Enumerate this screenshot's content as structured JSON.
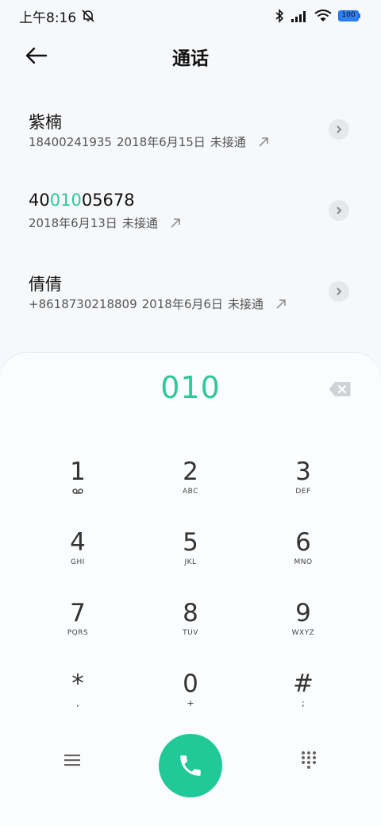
{
  "status_bar": {
    "time": "上午8:16",
    "battery": "100",
    "icons": [
      "alarm-off-icon",
      "bluetooth-icon",
      "signal-icon",
      "wifi-icon",
      "battery-icon"
    ]
  },
  "header": {
    "title": "通话",
    "back_icon": "back-arrow-icon"
  },
  "calls": [
    {
      "name_parts": [
        "紫楠",
        "",
        ""
      ],
      "number": "18400241935",
      "date": "2018年6月15日",
      "status": "未接通",
      "direction": "outgoing-arrow-icon"
    },
    {
      "name_parts": [
        "40",
        "010",
        "05678"
      ],
      "number": "",
      "date": "2018年6月13日",
      "status": "未接通",
      "direction": "outgoing-arrow-icon"
    },
    {
      "name_parts": [
        "倩倩",
        "",
        ""
      ],
      "number": "+8618730218809",
      "date": "2018年6月6日",
      "status": "未接通",
      "direction": "outgoing-arrow-icon"
    }
  ],
  "dialpad": {
    "input": "010",
    "highlight_color": "#2ec99a",
    "keys": [
      {
        "digit": "1",
        "sub": ""
      },
      {
        "digit": "2",
        "sub": "ABC"
      },
      {
        "digit": "3",
        "sub": "DEF"
      },
      {
        "digit": "4",
        "sub": "GHI"
      },
      {
        "digit": "5",
        "sub": "JKL"
      },
      {
        "digit": "6",
        "sub": "MNO"
      },
      {
        "digit": "7",
        "sub": "PQRS"
      },
      {
        "digit": "8",
        "sub": "TUV"
      },
      {
        "digit": "9",
        "sub": "WXYZ"
      },
      {
        "digit": "*",
        "sub": ","
      },
      {
        "digit": "0",
        "sub": "+"
      },
      {
        "digit": "#",
        "sub": ";"
      }
    ]
  },
  "bottom": {
    "call_color": "#20c997",
    "icons": [
      "menu-icon",
      "phone-icon",
      "keypad-icon"
    ]
  }
}
